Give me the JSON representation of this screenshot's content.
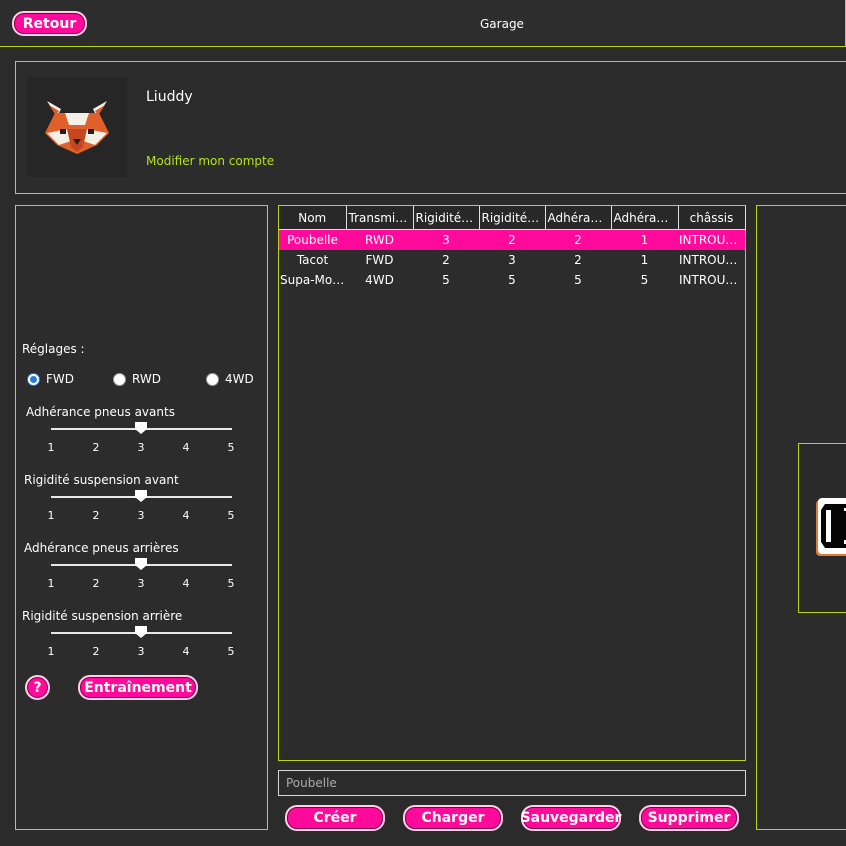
{
  "header": {
    "back_label": "Retour",
    "title": "Garage"
  },
  "profile": {
    "username": "Liuddy",
    "modify_link": "Modifier mon compte",
    "avatar_icon": "red-panda-avatar"
  },
  "settings": {
    "title": "Réglages :",
    "drive": {
      "options": [
        "FWD",
        "RWD",
        "4WD"
      ],
      "selected": "FWD"
    },
    "sliders": [
      {
        "label": "Adhérance pneus avants",
        "value": 3
      },
      {
        "label": "Rigidité suspension avant",
        "value": 3
      },
      {
        "label": "Adhérance pneus arrières",
        "value": 3
      },
      {
        "label": "Rigidité suspension arrière",
        "value": 3
      }
    ],
    "ticks": [
      "1",
      "2",
      "3",
      "4",
      "5"
    ],
    "help_label": "?",
    "training_label": "Entraînement"
  },
  "table": {
    "columns": [
      "Nom",
      "Transmiss...",
      "Rigidité s...",
      "Rigidité s...",
      "Adhéranc...",
      "Adhéranc...",
      "châssis"
    ],
    "rows": [
      [
        "Poubelle",
        "RWD",
        "3",
        "2",
        "2",
        "1",
        "INTROUVA..."
      ],
      [
        "Tacot",
        "FWD",
        "2",
        "3",
        "2",
        "1",
        "INTROUVA..."
      ],
      [
        "Supa-Mob...",
        "4WD",
        "5",
        "5",
        "5",
        "5",
        "INTROUVA..."
      ]
    ],
    "selected_row": 0
  },
  "name_input": {
    "value": "Poubelle"
  },
  "actions": {
    "create": "Créer",
    "load": "Charger",
    "save": "Sauvegarder",
    "delete": "Supprimer"
  },
  "colors": {
    "accent": "#ff0a9a",
    "border": "#b6d80e",
    "link": "#b6e21a",
    "background": "#2b2b2b"
  }
}
